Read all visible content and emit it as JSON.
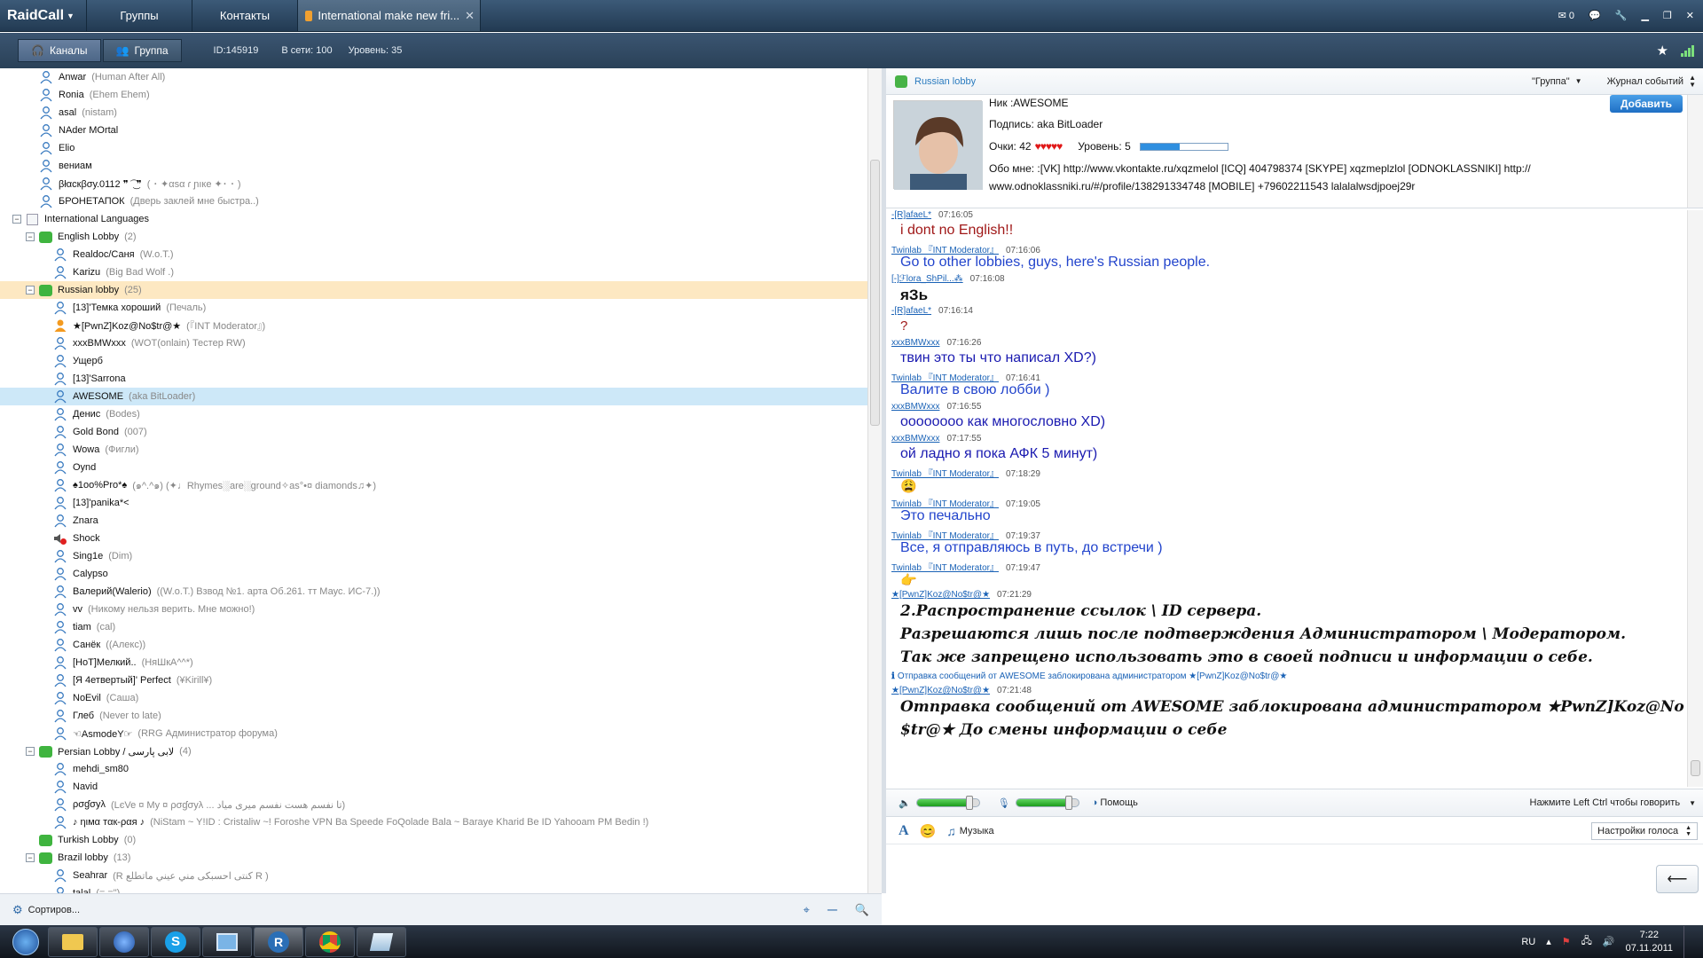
{
  "app": {
    "logo": "RaidCall"
  },
  "topbar": {
    "tabs": [
      {
        "label": "Группы"
      },
      {
        "label": "Контакты"
      }
    ],
    "active_tab": "International make new fri...",
    "mail_count": "0"
  },
  "subbar": {
    "channels_label": "Каналы",
    "group_label": "Группа",
    "id_text": "ID:145919",
    "online_text": "В сети: 100",
    "level_text": "Уровень: 35"
  },
  "tree": {
    "rows": [
      {
        "t": "user",
        "d": 2,
        "name": "Anwar",
        "note": "(Human After All)"
      },
      {
        "t": "user",
        "d": 2,
        "name": "Ronia",
        "note": "(Ehem Ehem)"
      },
      {
        "t": "user",
        "d": 2,
        "name": "asal",
        "note": "(nistam)"
      },
      {
        "t": "user",
        "d": 2,
        "name": "NAder MOrtal",
        "note": ""
      },
      {
        "t": "user",
        "d": 2,
        "name": "Elio",
        "note": ""
      },
      {
        "t": "user",
        "d": 2,
        "name": "вениам",
        "note": ""
      },
      {
        "t": "user",
        "d": 2,
        "name": "βłαcкβσу.0112 ❞ ͡ ͜ ❞",
        "note": "( ･ ✦αsα ɾ ɲıке ✦･ ･ )"
      },
      {
        "t": "user",
        "d": 2,
        "name": "БРОНЕТАПОК",
        "note": "(Дверь заклей мне быстра..)"
      },
      {
        "t": "cat",
        "d": 0,
        "name": "International Languages",
        "count": ""
      },
      {
        "t": "chan",
        "d": 1,
        "name": "English Lobby",
        "count": "(2)"
      },
      {
        "t": "user",
        "d": 3,
        "name": "Realdoc/Саня",
        "note": "(W.o.T.)"
      },
      {
        "t": "user",
        "d": 3,
        "name": "Karizu",
        "note": "(Big Bad Wolf .)"
      },
      {
        "t": "chan",
        "d": 1,
        "name": "Russian lobby",
        "count": "(25)",
        "hl": true
      },
      {
        "t": "user",
        "d": 3,
        "name": "[13]'Темка хороший",
        "note": "(Печаль)"
      },
      {
        "t": "mod",
        "d": 3,
        "name": "★[PwnZ]Koz@No$tr@★",
        "note": "(『INT Moderator』)"
      },
      {
        "t": "user",
        "d": 3,
        "name": "xxxBMWxxx",
        "note": "(WOT(onlain) Тестер RW)"
      },
      {
        "t": "user",
        "d": 3,
        "name": "Ущерб",
        "note": ""
      },
      {
        "t": "user",
        "d": 3,
        "name": "[13]'Sarrona",
        "note": ""
      },
      {
        "t": "user",
        "d": 3,
        "name": "AWESOME",
        "note": "(aka BitLoader)",
        "sel": true
      },
      {
        "t": "user",
        "d": 3,
        "name": "Денис",
        "note": "(Bodes)"
      },
      {
        "t": "user",
        "d": 3,
        "name": "Gold Bond",
        "note": "(007)"
      },
      {
        "t": "user",
        "d": 3,
        "name": "Wowa",
        "note": "(Фигли)"
      },
      {
        "t": "user",
        "d": 3,
        "name": "Oynd",
        "note": ""
      },
      {
        "t": "user",
        "d": 3,
        "name": "♠1oo%Pro*♠",
        "note": "(๑^.^๑) (✦♩Rhymes░are░ground✧as°•¤ diamonds♫✦)"
      },
      {
        "t": "user",
        "d": 3,
        "name": " [13]'panika*<",
        "note": ""
      },
      {
        "t": "user",
        "d": 3,
        "name": "Znara",
        "note": ""
      },
      {
        "t": "muted",
        "d": 3,
        "name": "Shock",
        "note": ""
      },
      {
        "t": "user",
        "d": 3,
        "name": "Sing1e",
        "note": "(Dim)"
      },
      {
        "t": "user",
        "d": 3,
        "name": "Calypso",
        "note": ""
      },
      {
        "t": "user",
        "d": 3,
        "name": "Валерий(Walerio)",
        "note": "((W.o.T.) Взвод №1. арта Об.261. тт Маус. ИС-7.))"
      },
      {
        "t": "user",
        "d": 3,
        "name": "vv",
        "note": "(Никому нельзя верить. Мне можно!)"
      },
      {
        "t": "user",
        "d": 3,
        "name": "tiam",
        "note": "(cal)"
      },
      {
        "t": "user",
        "d": 3,
        "name": "Санёк",
        "note": "((Алекс))"
      },
      {
        "t": "user",
        "d": 3,
        "name": "[НоТ]Мелкий..",
        "note": "(НяШкА^^*)"
      },
      {
        "t": "user",
        "d": 3,
        "name": "[Я 4етвертый]' Perfect",
        "note": "(¥Kirill¥)"
      },
      {
        "t": "user",
        "d": 3,
        "name": "NoEvil",
        "note": "(Саша)"
      },
      {
        "t": "user",
        "d": 3,
        "name": "Глеб",
        "note": "(Never to late)"
      },
      {
        "t": "user",
        "d": 3,
        "name": "☜AsmodeY☞",
        "note": "(RRG Администратор форума)"
      },
      {
        "t": "chan",
        "d": 1,
        "name": "Persian Lobby / لابی پارسی",
        "count": "(4)"
      },
      {
        "t": "user",
        "d": 3,
        "name": "mehdi_sm80",
        "note": ""
      },
      {
        "t": "user",
        "d": 3,
        "name": "Navid",
        "note": ""
      },
      {
        "t": "user",
        "d": 3,
        "name": "ρσɠσуλ",
        "note": "(LєVe ¤   My   ¤   ρσɠσуλ ... تا نفسم هست نفسم میری میاد)"
      },
      {
        "t": "user",
        "d": 3,
        "name": "♪ ηιмα тαк-ραя ♪",
        "note": "(NiStam ~ Y!ID : Cristaliw ~! Foroshe VPN Ba Speede FoQolade Bala ~ Baraye Kharid Be ID Yahooam PM Bedin !)"
      },
      {
        "t": "chan",
        "d": 1,
        "name": "Turkish Lobby",
        "count": "(0)",
        "noexp": true
      },
      {
        "t": "chan",
        "d": 1,
        "name": "Brazil lobby",
        "count": "(13)"
      },
      {
        "t": "user",
        "d": 3,
        "name": "Seahrar",
        "note": "(R کنتی احسبکی مني عيني ماتطلع R )"
      },
      {
        "t": "user",
        "d": 3,
        "name": "talal",
        "note": "(=.=\")"
      }
    ]
  },
  "left_footer": {
    "sort_label": "Сортиров..."
  },
  "right": {
    "channel_title": "Russian lobby",
    "group_dropdown": "\"Группа\"",
    "event_log": "Журнал событий",
    "add_button": "Добавить",
    "profile": {
      "nick": "Ник :AWESOME",
      "signature": "Подпись: aka BitLoader",
      "points_label": "Очки: 42",
      "level_label": "Уровень: 5",
      "level_progress": 0.45,
      "about_line1": "Обо мне: :[VK] http://www.vkontakte.ru/xqzmelol [ICQ] 404798374 [SKYPE] xqzmeplzlol [ODNOKLASSNIKI] http://",
      "about_line2": "www.odnoklassniki.ru/#/profile/138291334748 [MOBILE] +79602211543 lalalalwsdjpoej29r"
    },
    "chat": [
      {
        "kind": "meta",
        "name": "-[R]afaeL*",
        "time": "07:16:05"
      },
      {
        "kind": "msg",
        "text": "i dont no English!!",
        "color": "#a01818",
        "size": 16
      },
      {
        "kind": "meta",
        "name": "Twinlab 『INT Moderator』",
        "time": "07:16:06"
      },
      {
        "kind": "msg",
        "text": "Go to other lobbies, guys, here's Russian people.",
        "color": "#2244cc",
        "size": 16
      },
      {
        "kind": "meta",
        "name": "[-]ℱlora_ShPil...⁂",
        "time": "07:16:08"
      },
      {
        "kind": "msg",
        "text": "яЗь",
        "color": "#111",
        "size": 17,
        "bold": true
      },
      {
        "kind": "meta",
        "name": "-[R]afaeL*",
        "time": "07:16:14"
      },
      {
        "kind": "msg",
        "text": "?",
        "color": "#a01818",
        "size": 15
      },
      {
        "kind": "meta",
        "name": "xxxBMWxxx",
        "time": "07:16:26"
      },
      {
        "kind": "msg",
        "text": "твин это ты что написал XD?)",
        "color": "#1a1ab0",
        "size": 16
      },
      {
        "kind": "meta",
        "name": "Twinlab 『INT Moderator』",
        "time": "07:16:41"
      },
      {
        "kind": "msg",
        "text": "Валите в свою лобби )",
        "color": "#2244cc",
        "size": 16
      },
      {
        "kind": "meta",
        "name": "xxxBMWxxx",
        "time": "07:16:55"
      },
      {
        "kind": "msg",
        "text": "оооооооо как многословно XD)",
        "color": "#1a1ab0",
        "size": 16
      },
      {
        "kind": "meta",
        "name": "xxxBMWxxx",
        "time": "07:17:55"
      },
      {
        "kind": "msg",
        "text": "ой ладно я пока АФК 5 минут)",
        "color": "#1a1ab0",
        "size": 16
      },
      {
        "kind": "meta",
        "name": "Twinlab 『INT Moderator』",
        "time": "07:18:29"
      },
      {
        "kind": "emo",
        "text": "😩"
      },
      {
        "kind": "meta",
        "name": "Twinlab 『INT Moderator』",
        "time": "07:19:05"
      },
      {
        "kind": "msg",
        "text": "Это печально",
        "color": "#2244cc",
        "size": 16
      },
      {
        "kind": "meta",
        "name": "Twinlab 『INT Moderator』",
        "time": "07:19:37"
      },
      {
        "kind": "msg",
        "text": "Все, я отправляюсь в путь, до встречи )",
        "color": "#2244cc",
        "size": 16
      },
      {
        "kind": "meta",
        "name": "Twinlab 『INT Moderator』",
        "time": "07:19:47"
      },
      {
        "kind": "emo",
        "text": "👉"
      },
      {
        "kind": "meta",
        "name": "★[PwnZ]Koz@No$tr@★",
        "time": "07:21:29"
      },
      {
        "kind": "msg",
        "text": "2.Распространение ссылок \\ ID сервера.",
        "color": "#111",
        "size": 17,
        "bold": true,
        "italic": true
      },
      {
        "kind": "msg",
        "text": "   Разрешаются лишь после подтверждения Администратором \\ Модератором.",
        "color": "#111",
        "size": 17,
        "bold": true,
        "italic": true
      },
      {
        "kind": "msg",
        "text": "Так же  запрещено использовать это в своей подписи и информации о себе.",
        "color": "#111",
        "size": 17,
        "bold": true,
        "italic": true
      },
      {
        "kind": "sys",
        "text": "Отправка сообщений от AWESOME заблокирована администратором ★[PwnZ]Koz@No$tr@★"
      },
      {
        "kind": "meta",
        "name": "★[PwnZ]Koz@No$tr@★",
        "time": "07:21:48"
      },
      {
        "kind": "msg",
        "text": "Отправка сообщений от AWESOME заблокирована администратором ★PwnZ]Koz@No",
        "color": "#111",
        "size": 17,
        "bold": true,
        "italic": true
      },
      {
        "kind": "msg",
        "text": "$tr@★ До смены информации о себе",
        "color": "#111",
        "size": 17,
        "bold": true,
        "italic": true
      }
    ],
    "voice": {
      "help_label": "Помощь",
      "ptt_hint": "Нажмите Left Ctrl чтобы говорить",
      "speaker_level": 0.85,
      "mic_level": 0.85
    },
    "input": {
      "music_label": "Музыка",
      "voice_settings": "Настройки голоса"
    }
  },
  "taskbar": {
    "lang": "RU",
    "time": "7:22",
    "date": "07.11.2011"
  },
  "colors": {
    "top": "#2c4660",
    "accent": "#2f7fd0",
    "select": "#cde8f8",
    "highlight": "#fde8c2"
  }
}
